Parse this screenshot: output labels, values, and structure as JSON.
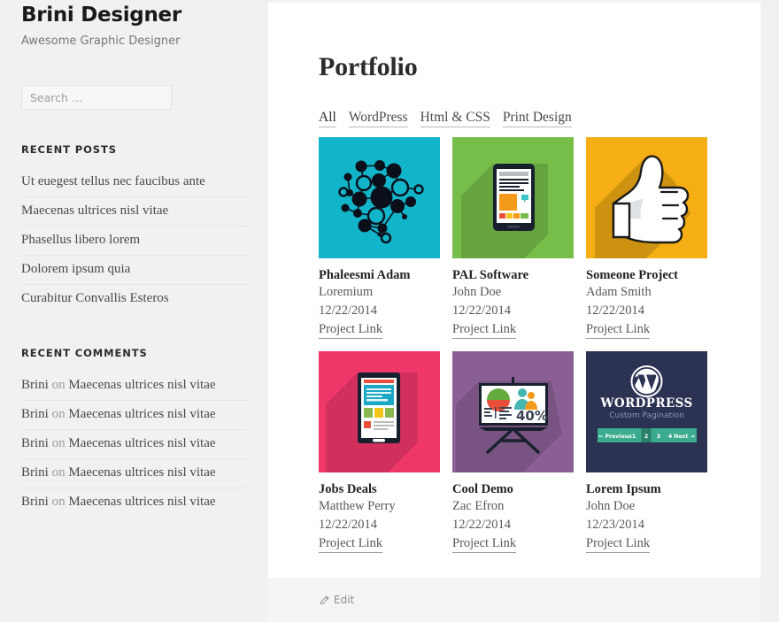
{
  "sidebar": {
    "site_title": "Brini Designer",
    "site_description": "Awesome Graphic Designer",
    "search": {
      "placeholder": "Search …",
      "value": "",
      "icon": "search-icon"
    },
    "recent_posts": {
      "title": "Recent Posts",
      "items": [
        "Ut euegest tellus nec faucibus ante",
        "Maecenas ultrices nisl vitae",
        "Phasellus libero lorem",
        "Dolorem ipsum quia",
        "Curabitur Convallis Esteros"
      ]
    },
    "recent_comments": {
      "title": "Recent Comments",
      "items": [
        {
          "author": "Brini",
          "on": "on",
          "post": "Maecenas ultrices nisl vitae"
        },
        {
          "author": "Brini",
          "on": "on",
          "post": "Maecenas ultrices nisl vitae"
        },
        {
          "author": "Brini",
          "on": "on",
          "post": "Maecenas ultrices nisl vitae"
        },
        {
          "author": "Brini",
          "on": "on",
          "post": "Maecenas ultrices nisl vitae"
        },
        {
          "author": "Brini",
          "on": "on",
          "post": "Maecenas ultrices nisl vitae"
        }
      ]
    }
  },
  "main": {
    "page_title": "Portfolio",
    "filters": [
      {
        "label": "All",
        "active": true
      },
      {
        "label": "WordPress",
        "active": false
      },
      {
        "label": "Html & CSS",
        "active": false
      },
      {
        "label": "Print Design",
        "active": false
      }
    ],
    "projects": [
      {
        "title": "Phaleesmi Adam",
        "client": "Loremium",
        "date": "12/22/2014",
        "link_label": "Project Link",
        "thumb": {
          "icon": "network-graph-icon",
          "bg": "#11b4c9"
        }
      },
      {
        "title": "PAL Software",
        "client": "John Doe",
        "date": "12/22/2014",
        "link_label": "Project Link",
        "thumb": {
          "icon": "tablet-device-icon",
          "bg": "#76bd4a"
        }
      },
      {
        "title": "Someone Project",
        "client": "Adam Smith",
        "date": "12/22/2014",
        "link_label": "Project Link",
        "thumb": {
          "icon": "thumbs-up-icon",
          "bg": "#f5ae13"
        }
      },
      {
        "title": "Jobs Deals",
        "client": "Matthew Perry",
        "date": "12/22/2014",
        "link_label": "Project Link",
        "thumb": {
          "icon": "smartphone-webpage-icon",
          "bg": "#f0376a"
        }
      },
      {
        "title": "Cool Demo",
        "client": "Zac Efron",
        "date": "12/22/2014",
        "link_label": "Project Link",
        "thumb": {
          "icon": "presentation-chart-icon",
          "bg": "#8a5f95"
        }
      },
      {
        "title": "Lorem Ipsum",
        "client": "John Doe",
        "date": "12/23/2014",
        "link_label": "Project Link",
        "thumb": {
          "icon": "wordpress-logo-icon",
          "bg": "#2b3252",
          "heading": "WordPress",
          "subheading": "Custom Pagination",
          "pagination": [
            "← Previous",
            "1",
            "2",
            "3",
            "4",
            "Next →"
          ],
          "pagination_active": "2",
          "pagination_bg": "#3aab8c",
          "pagination_active_bg": "#2a7f68"
        }
      }
    ]
  },
  "footer": {
    "edit_label": "Edit",
    "edit_icon": "pencil-icon"
  },
  "colors": {
    "page_bg": "#f1f1f1",
    "content_bg": "#ffffff",
    "footer_bg": "#f5f5f5",
    "text": "#4a4a4a",
    "heading": "#2b2b2b"
  }
}
